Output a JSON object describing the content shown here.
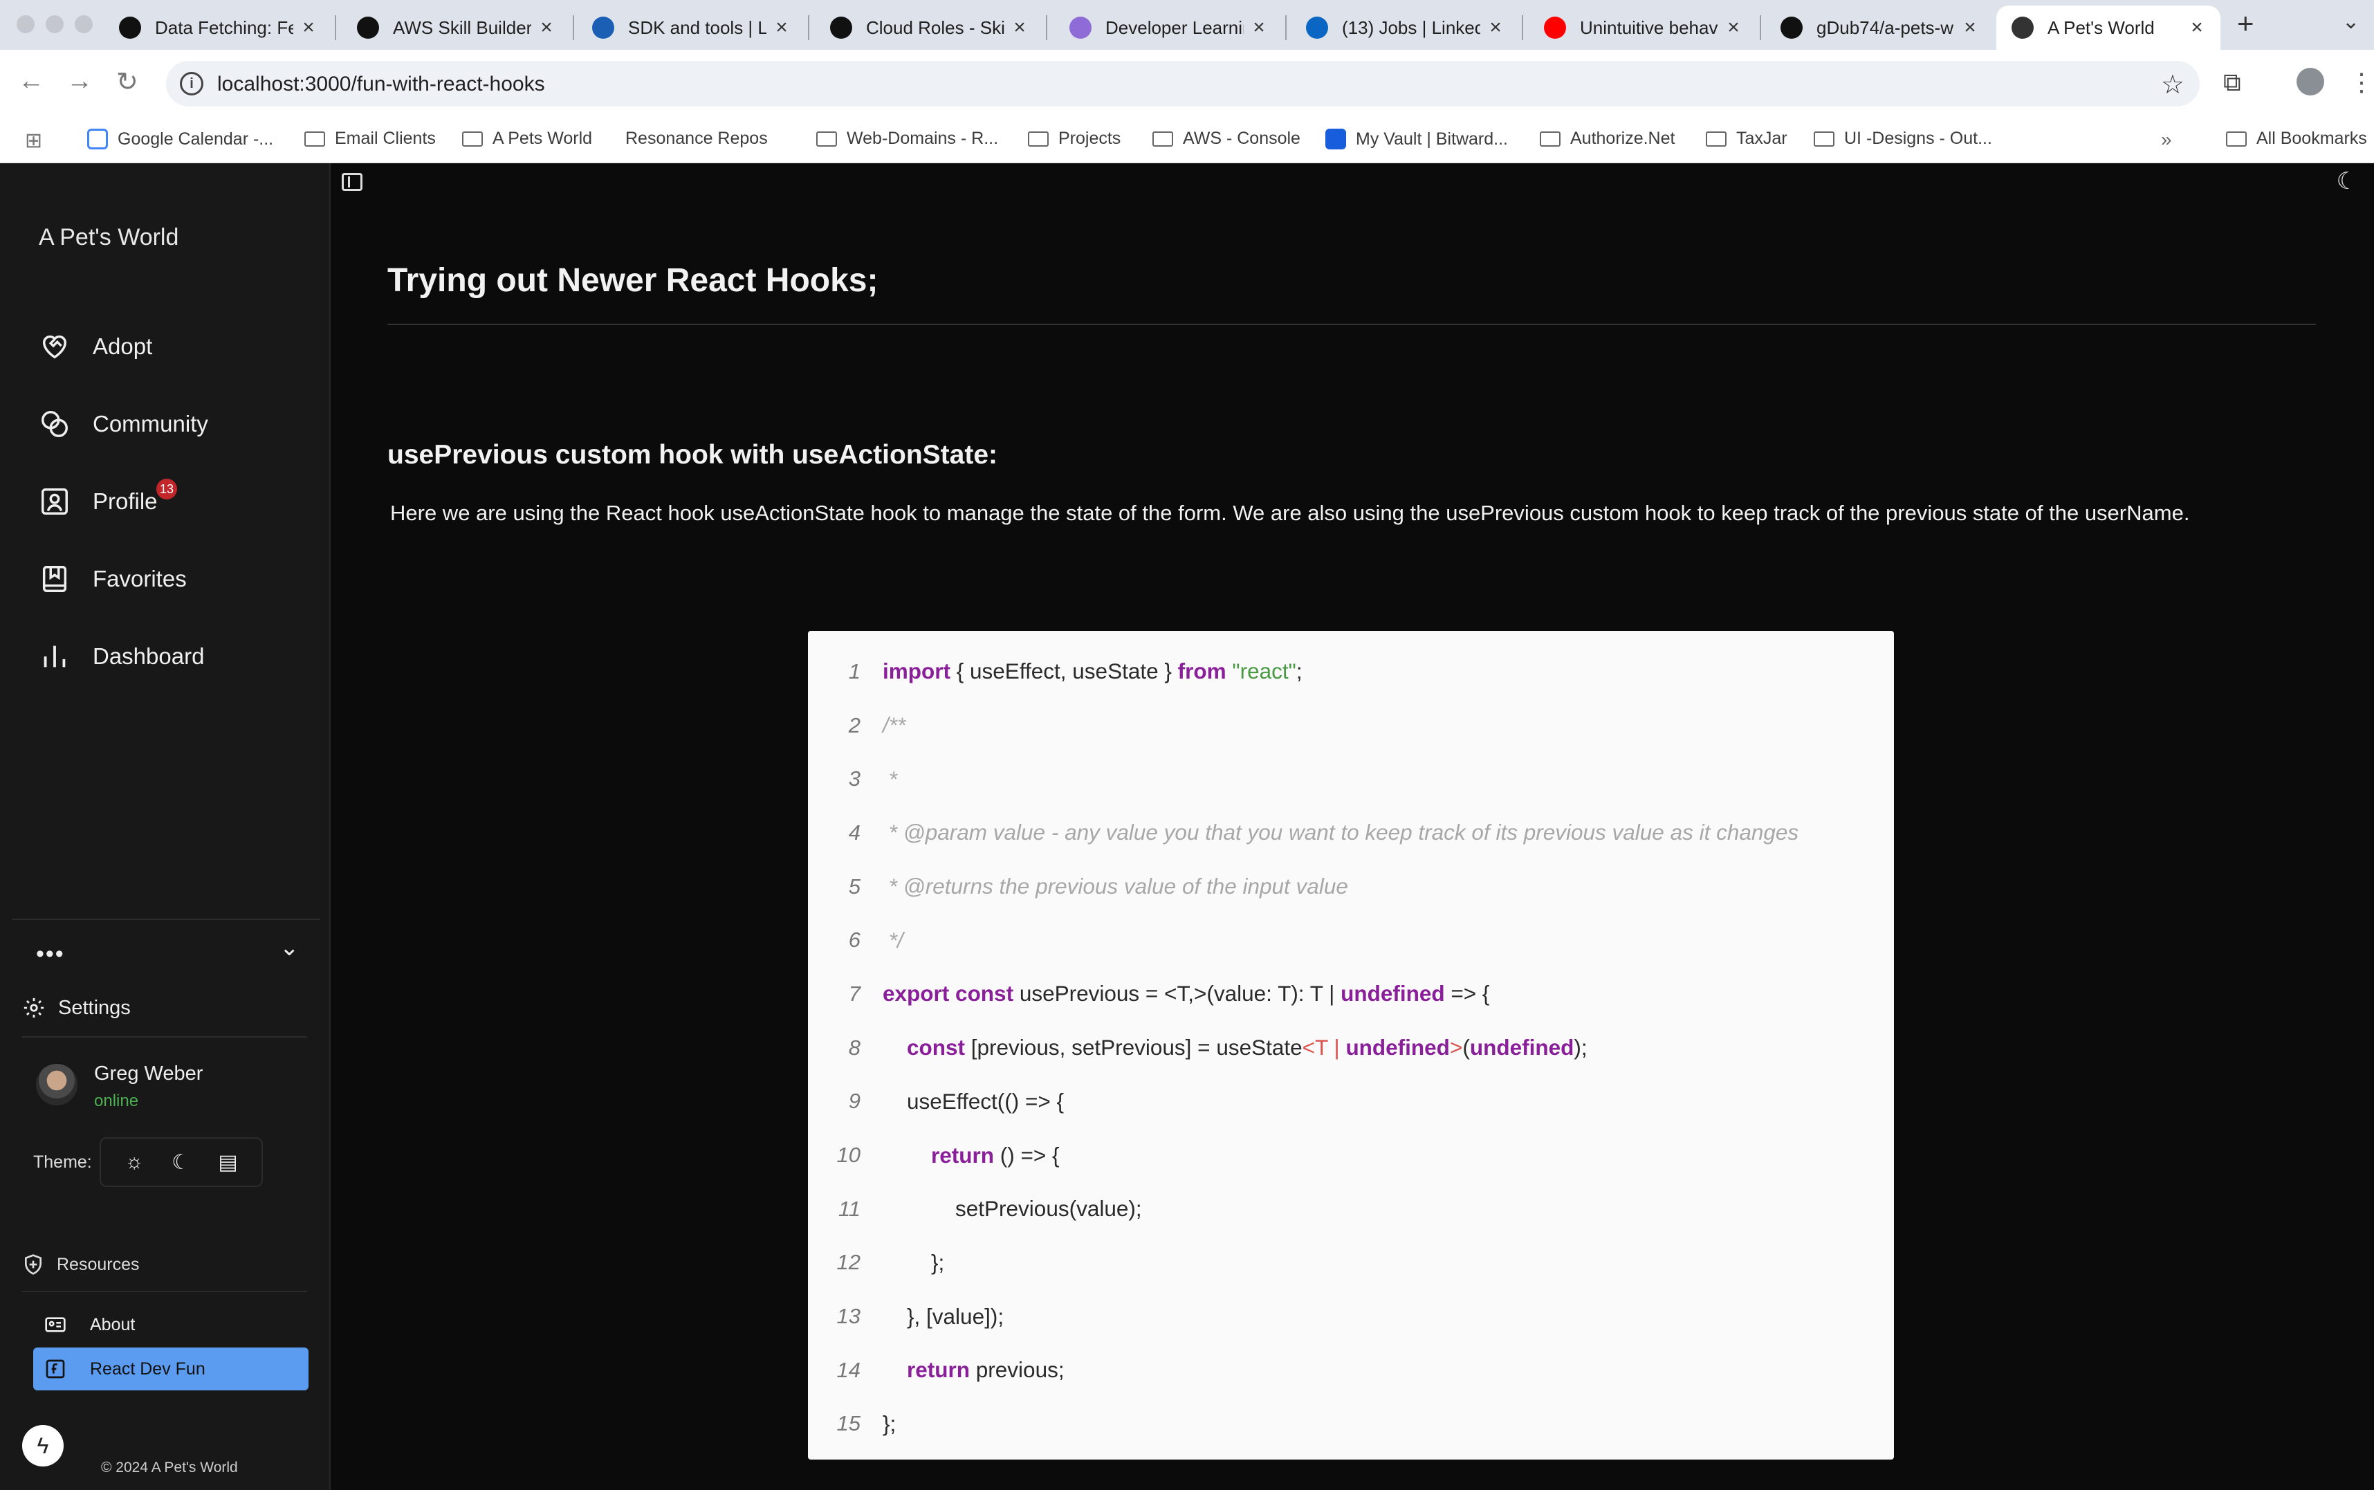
{
  "browser": {
    "tabs": [
      {
        "title": "Data Fetching: Fe",
        "icon": "next-js-icon",
        "color": "#111111",
        "active": false
      },
      {
        "title": "AWS Skill Builder",
        "icon": "aws-skill-builder-icon",
        "color": "#111111",
        "active": false
      },
      {
        "title": "SDK and tools | Li",
        "icon": "sdk-tools-icon",
        "color": "#1a5fb4",
        "active": false
      },
      {
        "title": "Cloud Roles - Skil",
        "icon": "cloud-roles-icon",
        "color": "#111111",
        "active": false
      },
      {
        "title": "Developer Learnin",
        "icon": "developer-learning-icon",
        "color": "#8e6bd6",
        "active": false
      },
      {
        "title": "(13) Jobs | Linked",
        "icon": "linkedin-icon",
        "color": "#0a66c2",
        "active": false
      },
      {
        "title": "Unintuitive behav",
        "icon": "youtube-icon",
        "color": "#ff0000",
        "active": false
      },
      {
        "title": "gDub74/a-pets-w",
        "icon": "github-icon",
        "color": "#111111",
        "active": false
      },
      {
        "title": "A Pet's World",
        "icon": "pets-world-icon",
        "color": "#333333",
        "active": true
      }
    ],
    "url": "localhost:3000/fun-with-react-hooks",
    "bookmarks": [
      {
        "label": "Google Calendar -...",
        "type": "calendar"
      },
      {
        "label": "Email Clients",
        "type": "folder"
      },
      {
        "label": "A Pets World",
        "type": "folder"
      },
      {
        "label": "Resonance Repos",
        "type": "link"
      },
      {
        "label": "Web-Domains - R...",
        "type": "folder"
      },
      {
        "label": "Projects",
        "type": "folder"
      },
      {
        "label": "AWS - Console",
        "type": "folder"
      },
      {
        "label": "My Vault | Bitward...",
        "type": "bitwarden"
      },
      {
        "label": "Authorize.Net",
        "type": "folder"
      },
      {
        "label": "TaxJar",
        "type": "folder"
      },
      {
        "label": "UI -Designs - Out...",
        "type": "folder"
      }
    ],
    "all_bookmarks": "All Bookmarks"
  },
  "sidebar": {
    "brand": "A Pet's World",
    "nav": [
      {
        "label": "Adopt",
        "icon": "heart-handshake-icon"
      },
      {
        "label": "Community",
        "icon": "community-icon"
      },
      {
        "label": "Profile",
        "icon": "profile-icon",
        "badge": "13"
      },
      {
        "label": "Favorites",
        "icon": "book-icon"
      },
      {
        "label": "Dashboard",
        "icon": "bar-chart-icon"
      }
    ],
    "more_label": "•••",
    "settings": "Settings",
    "user": {
      "name": "Greg Weber",
      "status": "online"
    },
    "theme_label": "Theme:",
    "resources": "Resources",
    "sub_items": [
      {
        "label": "About",
        "icon": "id-card-icon",
        "active": false
      },
      {
        "label": "React Dev Fun",
        "icon": "function-icon",
        "active": true
      }
    ],
    "copyright": "© 2024 A Pet's World"
  },
  "main": {
    "title": "Trying out Newer React Hooks;",
    "section_title": "usePrevious custom hook with useActionState:",
    "description": "Here we are using the React hook useActionState hook to manage the state of the form. We are also using the usePrevious custom hook to keep track of the previous state of the userName.",
    "code_lines": [
      {
        "n": "1",
        "html": "<span class='kw'>import</span> { useEffect, useState } <span class='kw'>from</span> <span class='str'>\"react\"</span>;"
      },
      {
        "n": "2",
        "html": "<span class='cmt'>/**</span>"
      },
      {
        "n": "3",
        "html": "<span class='cmt'> *</span>"
      },
      {
        "n": "4",
        "html": "<span class='cmt'> * @param value - any value you that you want to keep track of its previous value as it changes</span>"
      },
      {
        "n": "5",
        "html": "<span class='cmt'> * @returns the previous value of the input value</span>"
      },
      {
        "n": "6",
        "html": "<span class='cmt'> */</span>"
      },
      {
        "n": "7",
        "html": "<span class='kw'>export</span> <span class='kw'>const</span> usePrevious = &lt;T,&gt;(value: T): T | <span class='kw'>undefined</span> =&gt; {"
      },
      {
        "n": "8",
        "html": "    <span class='kw'>const</span> [previous, setPrevious] = useState<span class='typ'>&lt;T | </span><span class='kw'>undefined</span><span class='typ'>&gt;</span>(<span class='kw'>undefined</span>);"
      },
      {
        "n": "9",
        "html": "    useEffect(() =&gt; {"
      },
      {
        "n": "10",
        "html": "        <span class='kw'>return</span> () =&gt; {"
      },
      {
        "n": "11",
        "html": "            setPrevious(value);"
      },
      {
        "n": "12",
        "html": "        };"
      },
      {
        "n": "13",
        "html": "    }, [value]);"
      },
      {
        "n": "14",
        "html": "    <span class='kw'>return</span> previous;"
      },
      {
        "n": "15",
        "html": "};"
      }
    ]
  },
  "colors": {
    "accent": "#5b9cf0",
    "badge": "#c1262b",
    "online": "#4caf50",
    "keyword": "#8a1f9a",
    "string": "#4a9a43"
  }
}
